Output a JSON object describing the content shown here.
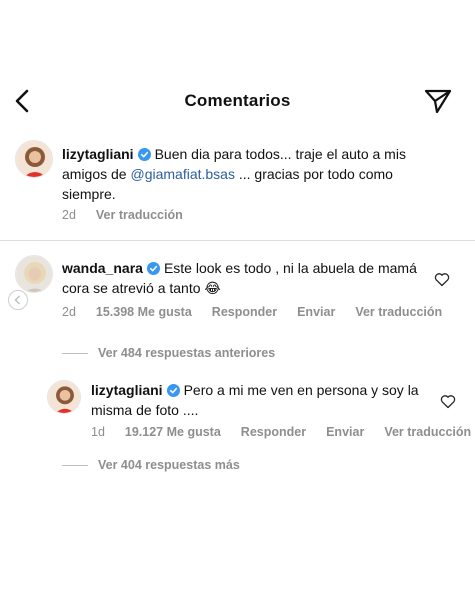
{
  "header": {
    "title": "Comentarios",
    "back_icon": "chevron-left-icon",
    "share_icon": "paper-plane-icon"
  },
  "comments": [
    {
      "username": "lizytagliani",
      "verified": true,
      "text_before_mention": "Buen dia para todos... traje el auto a mis amigos de",
      "mention": "@giamafiat.bsas",
      "text_after_mention": "... gracias por todo como siempre.",
      "meta": {
        "time": "2d",
        "translate": "Ver traducción"
      }
    },
    {
      "username": "wanda_nara",
      "verified": true,
      "text": "Este look es todo , ni la abuela de mamá cora se atrevió a tanto 😂",
      "meta": {
        "time": "2d",
        "likes": "15.398 Me gusta",
        "reply": "Responder",
        "send": "Enviar",
        "translate": "Ver traducción"
      },
      "thread_previous": "Ver 484 respuestas anteriores",
      "replies": [
        {
          "username": "lizytagliani",
          "verified": true,
          "text": "Pero a mi me ven en persona y soy la misma de foto ....",
          "meta": {
            "time": "1d",
            "likes": "19.127 Me gusta",
            "reply": "Responder",
            "send": "Enviar",
            "translate": "Ver traducción"
          }
        }
      ],
      "thread_more": "Ver 404 respuestas más"
    }
  ],
  "colors": {
    "mention": "#2c5e9c",
    "verified": "#3897f0",
    "secondary_text": "#8e8e8e"
  }
}
